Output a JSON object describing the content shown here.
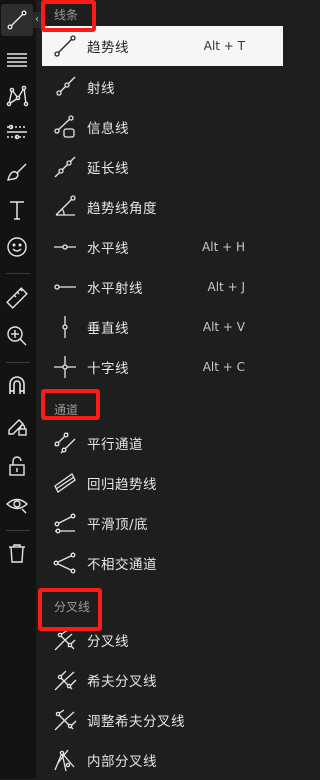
{
  "toolbar": {
    "tools": [
      {
        "name": "trend-line-tool-icon"
      },
      {
        "name": "fib-tool-icon"
      },
      {
        "name": "pattern-tool-icon"
      },
      {
        "name": "prediction-tool-icon"
      },
      {
        "name": "brush-tool-icon"
      },
      {
        "name": "text-tool-icon"
      },
      {
        "name": "emoji-tool-icon"
      },
      {
        "name": "ruler-tool-icon"
      },
      {
        "name": "zoom-in-tool-icon"
      },
      {
        "name": "magnet-tool-icon"
      },
      {
        "name": "lock-drawing-tool-icon"
      },
      {
        "name": "unlock-tool-icon"
      },
      {
        "name": "eye-tool-icon"
      },
      {
        "name": "trash-tool-icon"
      }
    ],
    "collapse_glyph": "‹"
  },
  "sections": {
    "lines": {
      "title": "线条",
      "items": [
        {
          "label": "趋势线",
          "hotkey": "Alt + T",
          "icon": "trend-line-icon"
        },
        {
          "label": "射线",
          "hotkey": "",
          "icon": "ray-icon"
        },
        {
          "label": "信息线",
          "hotkey": "",
          "icon": "info-line-icon"
        },
        {
          "label": "延长线",
          "hotkey": "",
          "icon": "extended-line-icon"
        },
        {
          "label": "趋势线角度",
          "hotkey": "",
          "icon": "trend-angle-icon"
        },
        {
          "label": "水平线",
          "hotkey": "Alt + H",
          "icon": "horizontal-line-icon"
        },
        {
          "label": "水平射线",
          "hotkey": "Alt + J",
          "icon": "horizontal-ray-icon"
        },
        {
          "label": "垂直线",
          "hotkey": "Alt + V",
          "icon": "vertical-line-icon"
        },
        {
          "label": "十字线",
          "hotkey": "Alt + C",
          "icon": "cross-line-icon"
        }
      ]
    },
    "channels": {
      "title": "通道",
      "items": [
        {
          "label": "平行通道",
          "icon": "parallel-channel-icon"
        },
        {
          "label": "回归趋势线",
          "icon": "regression-trend-icon"
        },
        {
          "label": "平滑顶/底",
          "icon": "flat-top-bottom-icon"
        },
        {
          "label": "不相交通道",
          "icon": "disjoint-channel-icon"
        }
      ]
    },
    "pitchforks": {
      "title": "分叉线",
      "items": [
        {
          "label": "分叉线",
          "icon": "pitchfork-icon"
        },
        {
          "label": "希夫分叉线",
          "icon": "schiff-pitchfork-icon"
        },
        {
          "label": "调整希夫分叉线",
          "icon": "modified-schiff-pitchfork-icon"
        },
        {
          "label": "内部分叉线",
          "icon": "inside-pitchfork-icon"
        }
      ]
    }
  },
  "colors": {
    "highlight": "#ff1a1a",
    "selected_bg": "#f6f6f6",
    "panel_bg": "#1e1e1e",
    "toolbar_bg": "#131313"
  }
}
